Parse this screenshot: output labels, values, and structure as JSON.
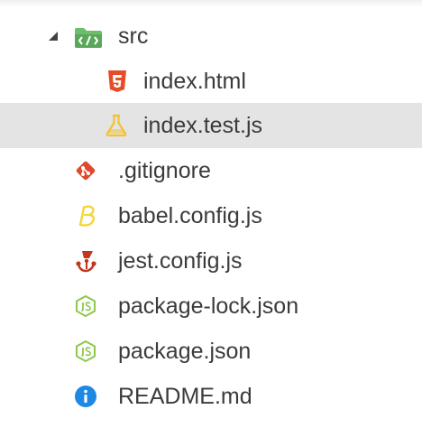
{
  "explorer": {
    "folder": {
      "label": "src",
      "icon": "folder-src-icon",
      "expanded": true
    },
    "children": [
      {
        "label": "index.html",
        "icon": "html5-icon"
      },
      {
        "label": "index.test.js",
        "icon": "flask-test-icon",
        "selected": true
      }
    ],
    "files": [
      {
        "label": ".gitignore",
        "icon": "git-icon"
      },
      {
        "label": "babel.config.js",
        "icon": "babel-icon"
      },
      {
        "label": "jest.config.js",
        "icon": "jest-icon"
      },
      {
        "label": "package-lock.json",
        "icon": "nodejs-icon"
      },
      {
        "label": "package.json",
        "icon": "nodejs-icon"
      },
      {
        "label": "README.md",
        "icon": "info-icon"
      }
    ]
  },
  "colors": {
    "selection_bg": "#e4e4e4",
    "text": "#3b3b3b",
    "folder_green": "#6dbe6b",
    "html_orange": "#e44d26",
    "test_yellow": "#f2c230",
    "git_red": "#e0492f",
    "babel_yellow": "#f5d53b",
    "jest_red": "#c2361f",
    "node_green": "#8cc84b",
    "info_blue": "#1e88e5"
  }
}
